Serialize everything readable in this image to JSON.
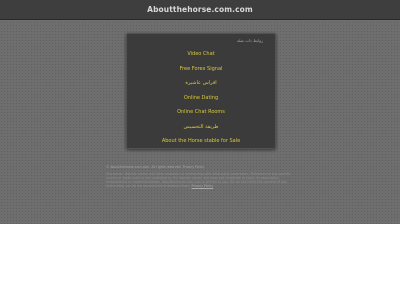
{
  "header": {
    "site_title": "Aboutthehorse.com.com"
  },
  "panel": {
    "header_label": "روابط ذات صلة",
    "links": [
      {
        "label": "Video Chat"
      },
      {
        "label": "Free Forex Signal"
      },
      {
        "label": "افراس عاشيرة"
      },
      {
        "label": "Online Dating"
      },
      {
        "label": "Online Chat Rooms"
      },
      {
        "label": "طريقة التخسيس"
      },
      {
        "label": "About the Horse stable for Sale"
      }
    ]
  },
  "footer": {
    "lead": "© Aboutthehorse.com.com. All rights reserved. Privacy Policy",
    "body": "Disclaimer: Domain owner and Sedo maintain no relationship with third party advertisers. Reference to any specific service or trade mark is not controlled by the domain owner and does not constitute or imply its association, endorsement or recommendation. Aboutthehorse.com.com is offered to you. We do not check the content of any linked sites, nor do we recommend or endorse them.",
    "privacy_link": "Privacy Policy"
  }
}
